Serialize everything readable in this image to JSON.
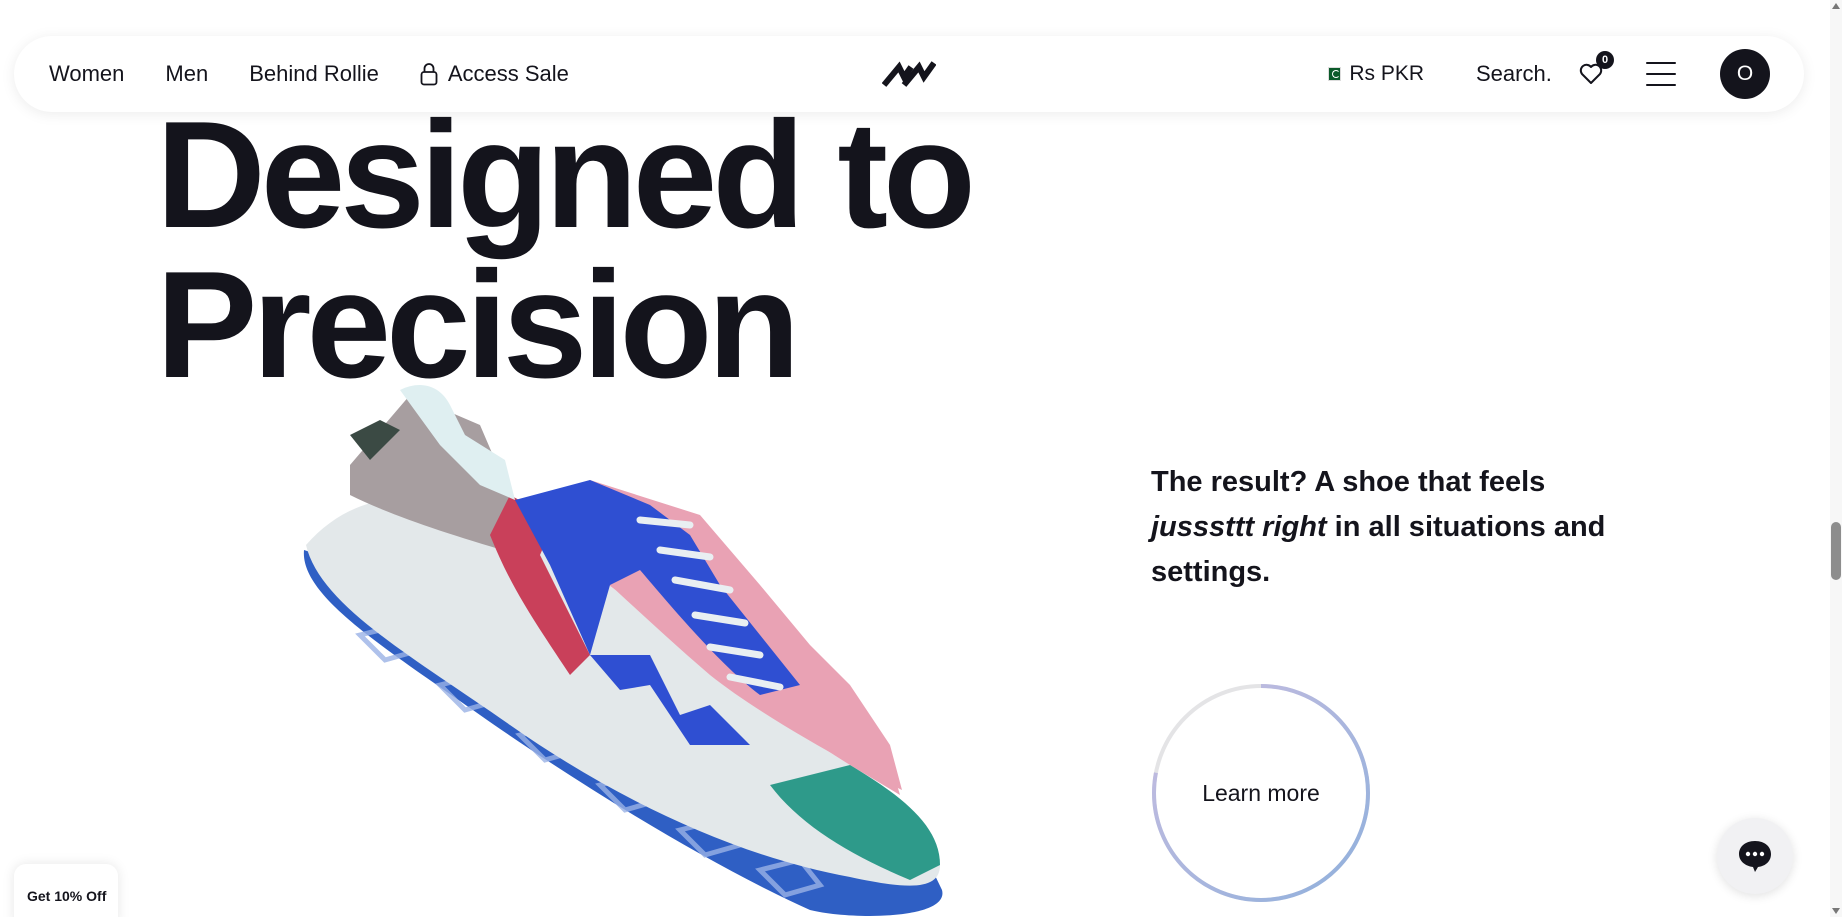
{
  "header": {
    "nav": [
      {
        "label": "Women"
      },
      {
        "label": "Men"
      },
      {
        "label": "Behind Rollie"
      }
    ],
    "access_sale_label": "Access Sale",
    "currency_label": "Rs PKR",
    "search_label": "Search...",
    "wishlist_count": "0",
    "avatar_initial": "O"
  },
  "hero": {
    "title_line1": "Designed to",
    "title_line2": "Precision"
  },
  "result": {
    "before": "The result? A shoe that feels ",
    "emphasis": "jusssttt right",
    "after": " in all situations and settings."
  },
  "learn_more": {
    "label": "Learn more",
    "progress": 0.78
  },
  "discount_tab": {
    "label": "Get 10% Off"
  },
  "colors": {
    "text": "#14141c",
    "ring_track": "#e4e4e6",
    "ring_gradient_start": "#8fb0dc",
    "ring_gradient_end": "#c9bde0"
  }
}
